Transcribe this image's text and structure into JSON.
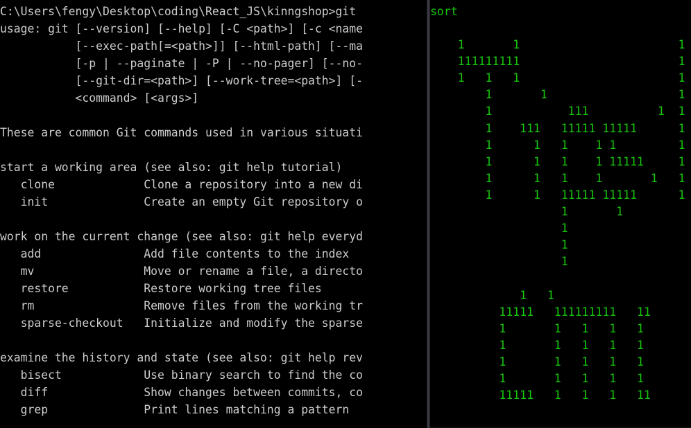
{
  "terminal": {
    "background_color": "#000000",
    "left_text_color": "#cccccc",
    "right_text_color": "#16c60c"
  },
  "left_pane": {
    "prompt_line": "C:\\Users\\fengy\\Desktop\\coding\\React_JS\\kinngshop>git",
    "lines": [
      "C:\\Users\\fengy\\Desktop\\coding\\React_JS\\kinngshop>git",
      "usage: git [--version] [--help] [-C <path>] [-c <name",
      "           [--exec-path[=<path>]] [--html-path] [--ma",
      "           [-p | --paginate | -P | --no-pager] [--no-",
      "           [--git-dir=<path>] [--work-tree=<path>] [-",
      "           <command> [<args>]",
      "",
      "These are common Git commands used in various situati",
      "",
      "start a working area (see also: git help tutorial)",
      "   clone             Clone a repository into a new di",
      "   init              Create an empty Git repository o",
      "",
      "work on the current change (see also: git help everyd",
      "   add               Add file contents to the index",
      "   mv                Move or rename a file, a directo",
      "   restore           Restore working tree files",
      "   rm                Remove files from the working tr",
      "   sparse-checkout   Initialize and modify the sparse",
      "",
      "examine the history and state (see also: git help rev",
      "   bisect            Use binary search to find the co",
      "   diff              Show changes between commits, co",
      "   grep              Print lines matching a pattern"
    ]
  },
  "right_pane": {
    "prompt": "sort",
    "art_color": "#16c60c",
    "art_char": "1",
    "art_lines": [
      "",
      "    1       1                       1",
      "    111111111                       1",
      "    1   1   1                       1",
      "        1       1                   1",
      "        1           111          1  1",
      "        1    111   11111 11111      1",
      "        1      1   1    1 1         1",
      "        1      1   1    1 11111     1",
      "        1      1   1    1       1   1",
      "        1      1   11111 11111      1",
      "                   1       1",
      "                   1",
      "                   1",
      "                   1",
      "",
      "             1   1",
      "          11111   111111111   11",
      "          1       1   1   1   1",
      "          1       1   1   1   1",
      "          1       1   1   1   1",
      "          1       1   1   1   1",
      "          11111   1   1   1   11"
    ]
  }
}
